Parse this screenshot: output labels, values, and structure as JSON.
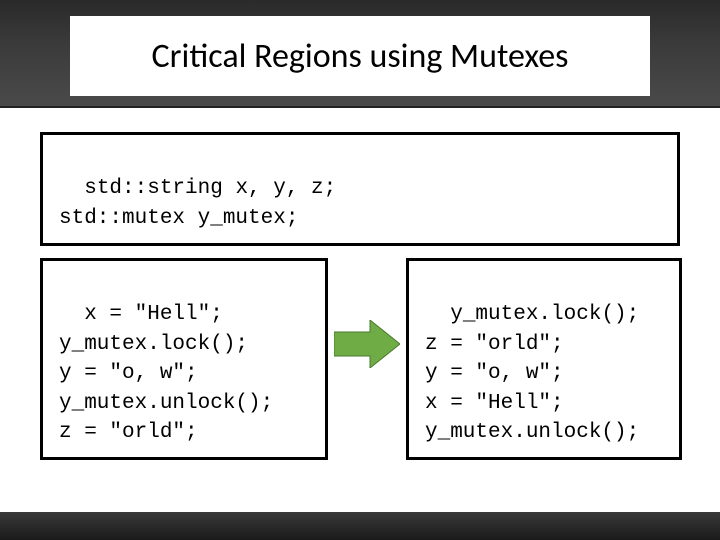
{
  "title": "Critical Regions using Mutexes",
  "declarations": "std::string x, y, z;\nstd::mutex y_mutex;",
  "left_code": "x = \"Hell\";\ny_mutex.lock();\ny = \"o, w\";\ny_mutex.unlock();\nz = \"orld\";",
  "right_code": "y_mutex.lock();\nz = \"orld\";\ny = \"o, w\";\nx = \"Hell\";\ny_mutex.unlock();",
  "arrow_color": "#6fac46"
}
